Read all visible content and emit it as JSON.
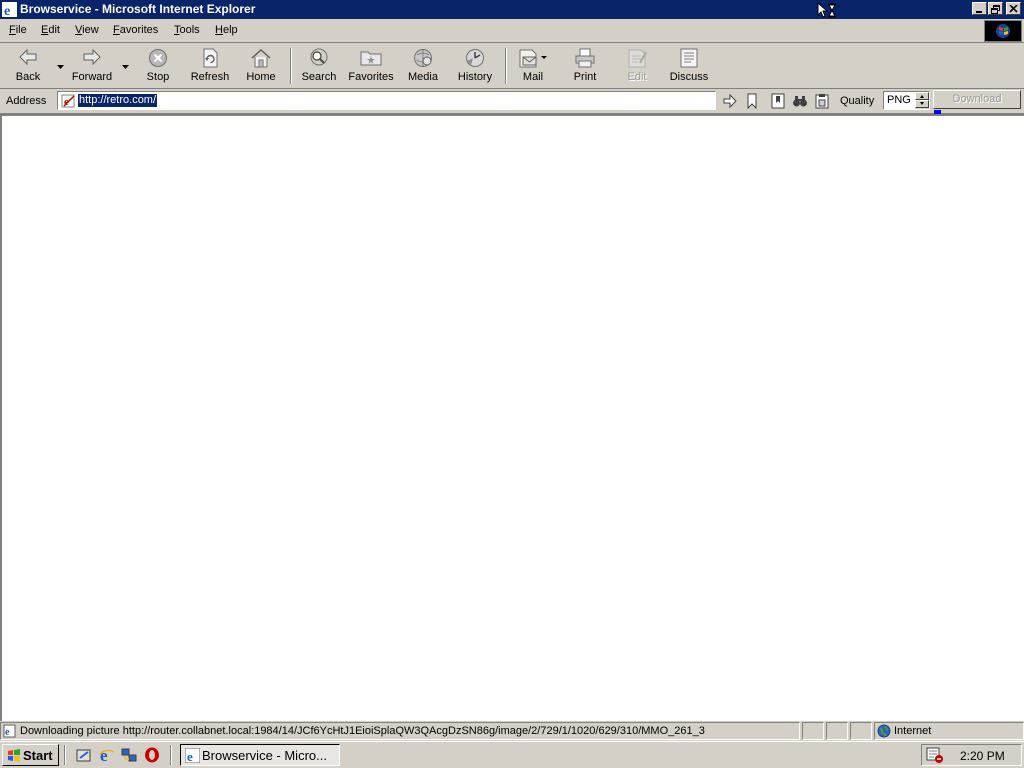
{
  "window": {
    "title": "Browservice - Microsoft Internet Explorer"
  },
  "menu": {
    "items": [
      {
        "label": "File",
        "accel": "F",
        "rest": "ile"
      },
      {
        "label": "Edit",
        "accel": "E",
        "rest": "dit"
      },
      {
        "label": "View",
        "accel": "V",
        "rest": "iew"
      },
      {
        "label": "Favorites",
        "accel": "F",
        "rest": "avorites"
      },
      {
        "label": "Tools",
        "accel": "T",
        "rest": "ools"
      },
      {
        "label": "Help",
        "accel": "H",
        "rest": "elp"
      }
    ]
  },
  "toolbar": {
    "back": "Back",
    "forward": "Forward",
    "stop": "Stop",
    "refresh": "Refresh",
    "home": "Home",
    "search": "Search",
    "favorites": "Favorites",
    "media": "Media",
    "history": "History",
    "mail": "Mail",
    "print": "Print",
    "edit": "Edit",
    "discuss": "Discuss"
  },
  "address": {
    "label": "Address",
    "url": "http://retro.com/"
  },
  "quality": {
    "label": "Quality",
    "value": "PNG"
  },
  "download": {
    "label": "Download"
  },
  "status": {
    "text": "Downloading picture http://router.collabnet.local:1984/14/JCf6YcHtJ1EioiSplaQW3QAcgDzSN86g/image/2/729/1/1020/629/310/MMO_261_3",
    "zone": "Internet"
  },
  "taskbar": {
    "start": "Start",
    "task_label": "Browservice - Micro...",
    "clock": "2:20 PM"
  },
  "colors": {
    "titlebar": "#0a246a",
    "chrome": "#d4d0c8",
    "selection": "#0a246a",
    "progress": "#0000ff",
    "opera_red": "#cc0000"
  }
}
